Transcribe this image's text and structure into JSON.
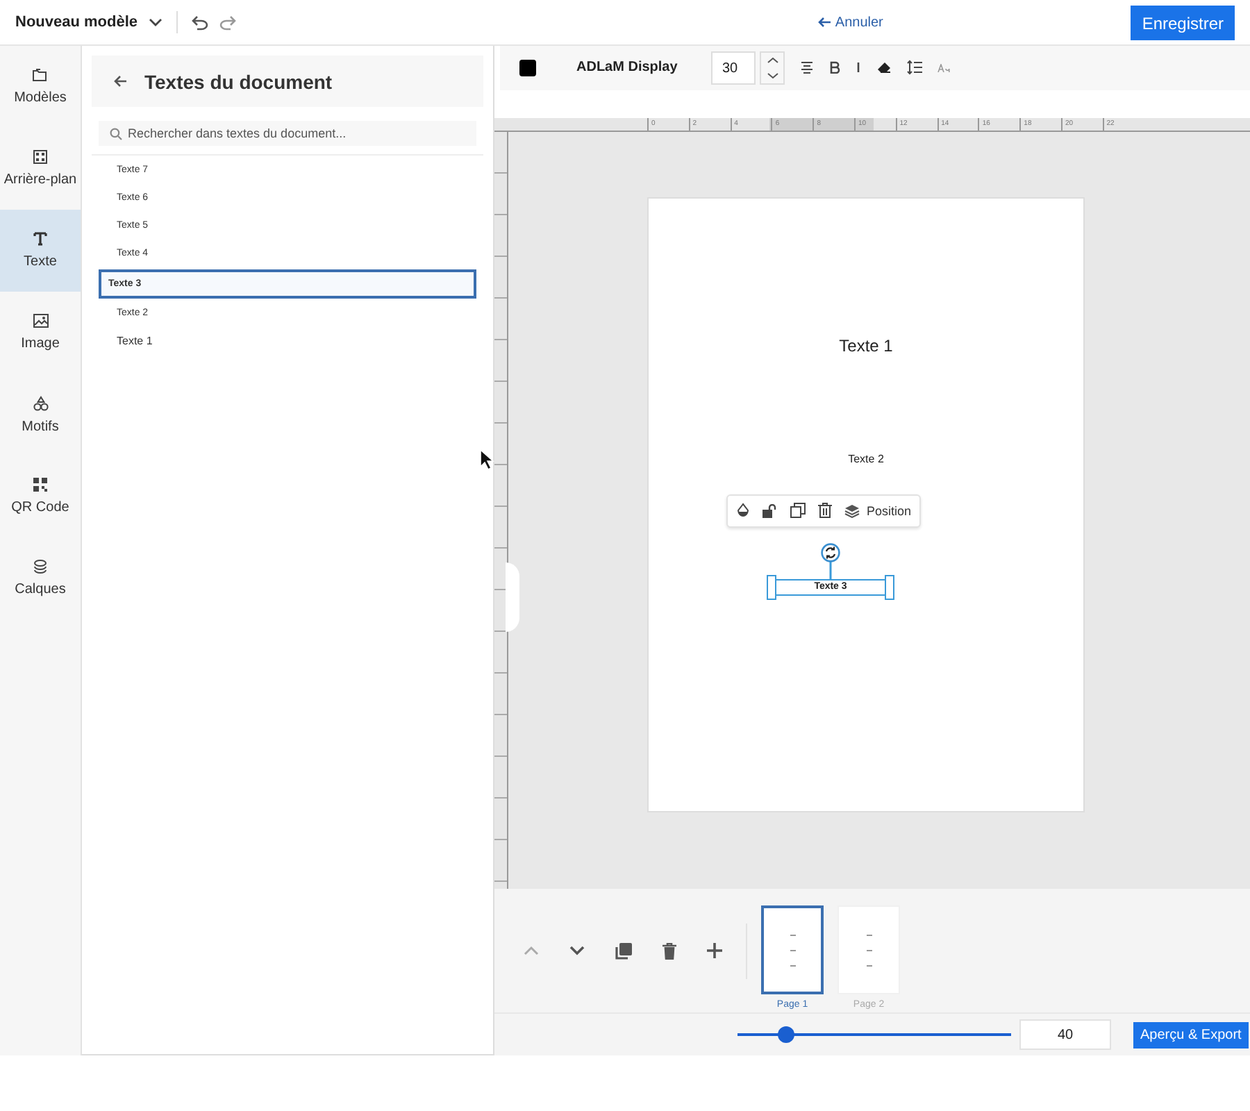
{
  "header": {
    "title": "Nouveau modèle",
    "cancel": "Annuler",
    "save": "Enregistrer"
  },
  "nav": [
    {
      "label": "Modèles",
      "selected": false
    },
    {
      "label": "Arrière-plan",
      "selected": false
    },
    {
      "label": "Texte",
      "selected": true
    },
    {
      "label": "Image",
      "selected": false
    },
    {
      "label": "Motifs",
      "selected": false
    },
    {
      "label": "QR Code",
      "selected": false
    },
    {
      "label": "Calques",
      "selected": false
    }
  ],
  "panel": {
    "title": "Textes du document",
    "search_placeholder": "Rechercher dans textes du document...",
    "items": [
      {
        "label": "Texte 7",
        "selected": false
      },
      {
        "label": "Texte 6",
        "selected": false
      },
      {
        "label": "Texte 5",
        "selected": false
      },
      {
        "label": "Texte 4",
        "selected": false
      },
      {
        "label": "Texte 3",
        "selected": true
      },
      {
        "label": "Texte 2",
        "selected": false
      },
      {
        "label": "Texte 1",
        "selected": false
      }
    ]
  },
  "toolbar": {
    "font": "ADLaM Display",
    "size": "30"
  },
  "ruler": {
    "labels": [
      "0",
      "2",
      "4",
      "6",
      "8",
      "10",
      "12",
      "14",
      "16",
      "18",
      "20",
      "22"
    ]
  },
  "page": {
    "texts": [
      {
        "text": "Texte 1",
        "kind": "large"
      },
      {
        "text": "Texte 2",
        "kind": "small"
      },
      {
        "text": "Texte 3",
        "kind": "selected"
      }
    ],
    "context_label": "Position"
  },
  "pages": [
    {
      "label": "Page 1",
      "selected": true
    },
    {
      "label": "Page 2",
      "selected": false
    }
  ],
  "zoom": {
    "level": 0.18,
    "value": "40"
  },
  "export": "Aperçu & Export"
}
